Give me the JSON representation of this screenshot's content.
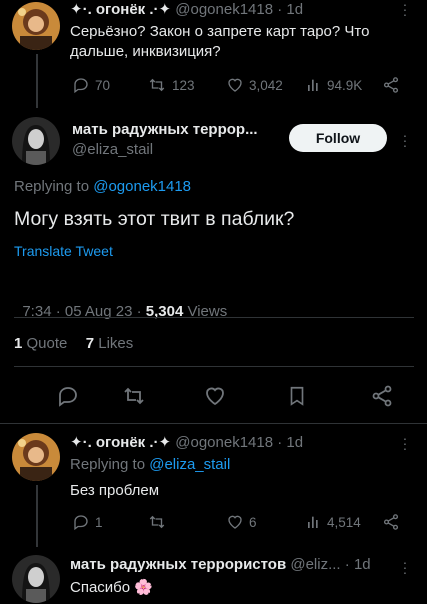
{
  "tweet_parent": {
    "name": "✦·. огонёк .·✦",
    "handle": "@ogonek1418",
    "time": "1d",
    "separator": "·",
    "text": "Серьёзно? Закон о запрете карт таро? Что дальше, инквизиция?",
    "reply_count": "70",
    "retweet_count": "123",
    "like_count": "3,042",
    "views_count": "94.9K"
  },
  "main_tweet": {
    "name": "мать радужных террор...",
    "handle": "@eliza_stail",
    "follow_label": "Follow",
    "replying_prefix": "Replying to",
    "replying_to": "@ogonek1418",
    "text": "Могу взять этот твит в паблик?",
    "translate_label": "Translate Tweet",
    "timestamp": "7:34 · 05 Aug 23 · ",
    "views_value": "5,304",
    "views_label": " Views",
    "quotes_count": "1",
    "quotes_label": "Quote",
    "likes_count": "7",
    "likes_label": "Likes"
  },
  "reply1": {
    "name": "✦·. огонёк .·✦",
    "handle": "@ogonek1418",
    "time": "1d",
    "separator": "·",
    "replying_prefix": "Replying to",
    "replying_to": "@eliza_stail",
    "text": "Без проблем",
    "reply_count": "1",
    "like_count": "6",
    "views_count": "4,514"
  },
  "reply2": {
    "name": "мать радужных террористов",
    "handle": "@eliz...",
    "time": "1d",
    "separator": "·",
    "text": "Спасибо 🌸"
  },
  "colors": {
    "background": "#000000",
    "text": "#e7e9ea",
    "muted": "#71767b",
    "link": "#1d9bf0",
    "divider": "#2f3336"
  }
}
